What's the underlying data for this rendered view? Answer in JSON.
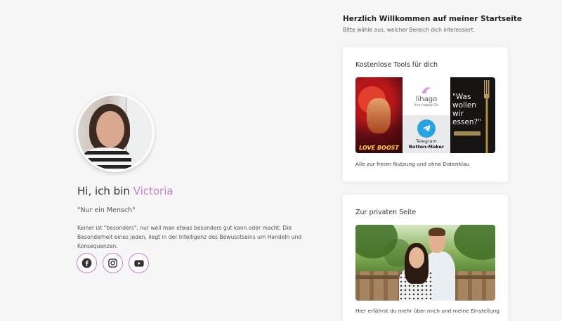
{
  "profile": {
    "greeting_prefix": "Hi, ich bin",
    "name": "Victoria",
    "quote": "\"Nur ein Mensch\"",
    "bio": "Keiner ist \"besonders\", nur weil man etwas besonders gut kann oder macht. Die Besonderheit eines jeden, liegt in der Intelligenz des Bewusstseins um Handeln und Konsequenzen.",
    "socials": [
      "facebook-icon",
      "instagram-icon",
      "youtube-icon"
    ]
  },
  "welcome": {
    "title": "Herzlich Willkommen auf meiner Startseite",
    "subtitle": "Bitte wähle aus, welcher Bereich dich interessiert."
  },
  "tools_card": {
    "title": "Kostenlose Tools für dich",
    "caption": "Alle zur freien Nutzung und ohne Datenklau",
    "tiles": {
      "lovebooster": "LOVE BOOST",
      "lihago_name": "lihago",
      "lihago_tagline": "live happy Go",
      "telegram_line1": "Telegram",
      "telegram_line2": "Button-Maker",
      "food_text": "\"Was\nwollen\nwir\nessen?\""
    }
  },
  "private_card": {
    "title": "Zur privaten Seite",
    "caption": "Hier erfährst du mehr über mich und meine Einstellung"
  },
  "colors": {
    "accent": "#c97fd0",
    "background": "#f7f6f7",
    "telegram": "#27a3e2"
  }
}
